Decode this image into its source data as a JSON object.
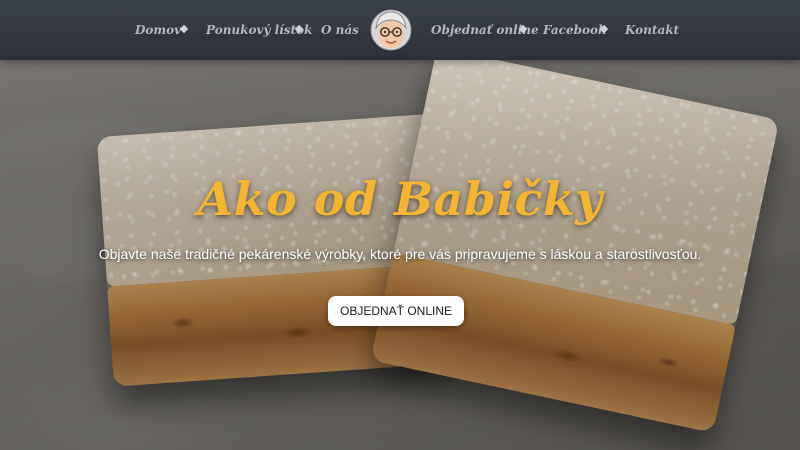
{
  "nav": {
    "items": [
      {
        "label": "Domov"
      },
      {
        "label": "Ponukový lístok"
      },
      {
        "label": "O nás"
      },
      {
        "label": "Objednať online"
      },
      {
        "label": "Facebook"
      },
      {
        "label": "Kontakt"
      }
    ],
    "separator_icon": "diamond-icon",
    "logo_icon": "grandmother-face-icon"
  },
  "hero": {
    "title": "Ako od Babičky",
    "subtitle": "Objavte naše tradičné pekárenské výrobky, ktoré pre vás pripravujeme s láskou a starostlivosťou.",
    "cta_label": "OBJEDNAŤ ONLINE"
  },
  "colors": {
    "navbar": "#2f343c",
    "nav_text": "#b3b8bf",
    "title": "#f5b531",
    "button_bg": "#ffffff"
  }
}
